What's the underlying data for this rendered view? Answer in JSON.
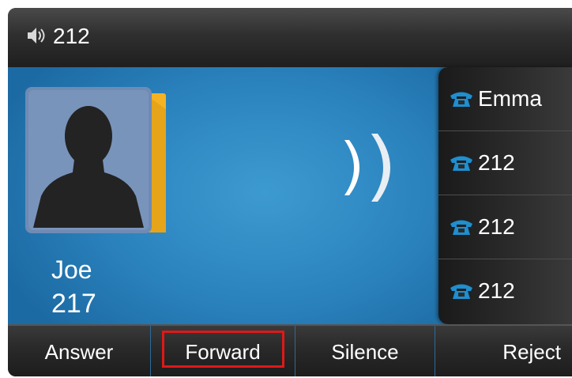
{
  "status_bar": {
    "title": "212",
    "icon": "speaker-icon"
  },
  "caller": {
    "name": "Joe",
    "number": "217",
    "avatar_icon": "contact-silhouette-icon"
  },
  "incoming_indicator_icon": "ringing-waves-icon",
  "line_keys": [
    {
      "label": "Emma",
      "icon": "phone-icon"
    },
    {
      "label": "212",
      "icon": "phone-icon"
    },
    {
      "label": "212",
      "icon": "phone-icon"
    },
    {
      "label": "212",
      "icon": "phone-icon"
    }
  ],
  "softkeys": {
    "answer": "Answer",
    "forward": "Forward",
    "silence": "Silence",
    "reject": "Reject"
  },
  "colors": {
    "accent_blue": "#2b83be",
    "avatar_tab": "#f5b323",
    "phone_icon": "#1e8fd0",
    "highlight": "#e01818"
  }
}
